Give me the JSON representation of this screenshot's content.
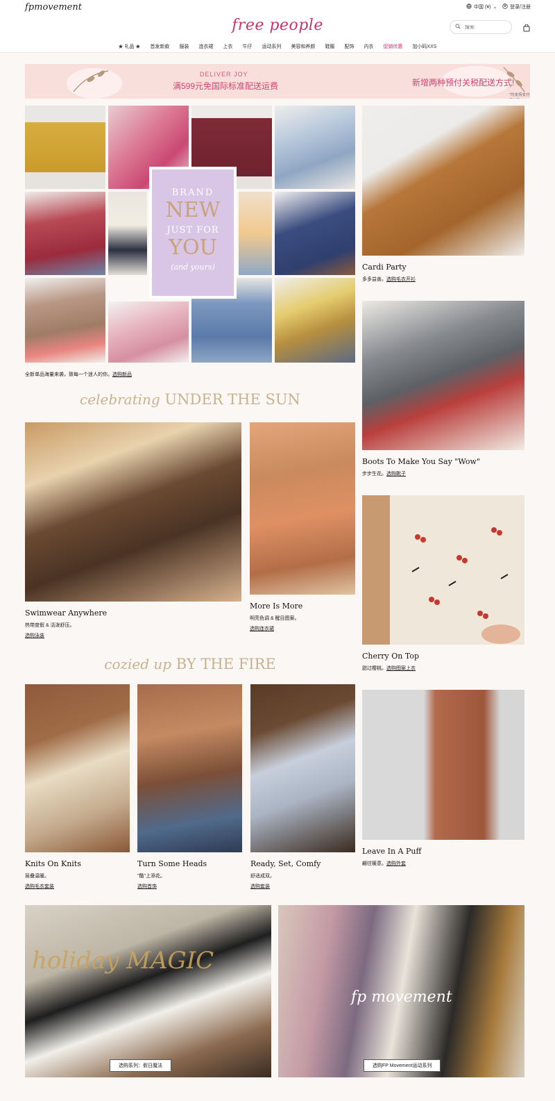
{
  "header": {
    "top_logo": "fpmovement",
    "region": "中国 (¥)",
    "login": "登录/注册",
    "brand": "free people",
    "search_placeholder": "搜索"
  },
  "nav": [
    "★ 礼品 ★",
    "首发新款",
    "服装",
    "连衣裙",
    "上衣",
    "牛仔",
    "运动系列",
    "美容和养颜",
    "鞋履",
    "配饰",
    "内衣",
    "促销优惠",
    "加小码XXS"
  ],
  "banner": {
    "deliver": "DELIVER JOY",
    "shipping": "满599元免国际标准配送运费",
    "payment": "新增两种预付关税配送方式!",
    "note": "*均支持支付宝付款"
  },
  "brand_new": {
    "line1": "BRAND",
    "line2": "NEW",
    "line3": "JUST FOR",
    "line4": "YOU",
    "line5": "(and yours)"
  },
  "collage_caption": {
    "text": "全新单品海量来袭，致每一个迷人的你。",
    "link": "选购新品"
  },
  "headings": {
    "sun_script": "celebrating",
    "sun_caps": "UNDER THE SUN",
    "fire_script": "cozied up",
    "fire_caps": "BY THE FIRE"
  },
  "cards": {
    "cardi": {
      "title": "Cardi Party",
      "desc": "多多益善。",
      "link": "选购毛衣开衫"
    },
    "boots": {
      "title": "Boots To Make You Say \"Wow\"",
      "desc": "步步生花。",
      "link": "选购靴子"
    },
    "swim": {
      "title": "Swimwear Anywhere",
      "desc": "热带度假 & 活泼舒压。",
      "link": "选购泳装"
    },
    "more": {
      "title": "More Is More",
      "desc": "明亮色调 & 醒目图案。",
      "link": "选购连衣裙"
    },
    "cherry": {
      "title": "Cherry On Top",
      "desc": "甜过樱桃。",
      "link": "选购图案上衣"
    },
    "knits": {
      "title": "Knits On Knits",
      "desc": "层叠温暖。",
      "link": "选购毛衣套装"
    },
    "heads": {
      "title": "Turn Some Heads",
      "desc": "\"酷\"上添花。",
      "link": "选购首饰"
    },
    "comfy": {
      "title": "Ready, Set, Comfy",
      "desc": "舒适成双。",
      "link": "选购套装"
    },
    "puff": {
      "title": "Leave In A Puff",
      "desc": "翩往暖意。",
      "link": "选购外套"
    }
  },
  "bottom": {
    "holiday_overlay": "holiday MAGIC",
    "holiday_cta": "选购系列：假日魔法",
    "fpm_overlay": "fp movement",
    "fpm_cta": "选购FP Movement运动系列"
  },
  "colors": {
    "brand": "#c8346b",
    "banner_bg": "#f8dfdc",
    "page_bg": "#fbf7f5",
    "heading_gold": "#c8b28e"
  }
}
